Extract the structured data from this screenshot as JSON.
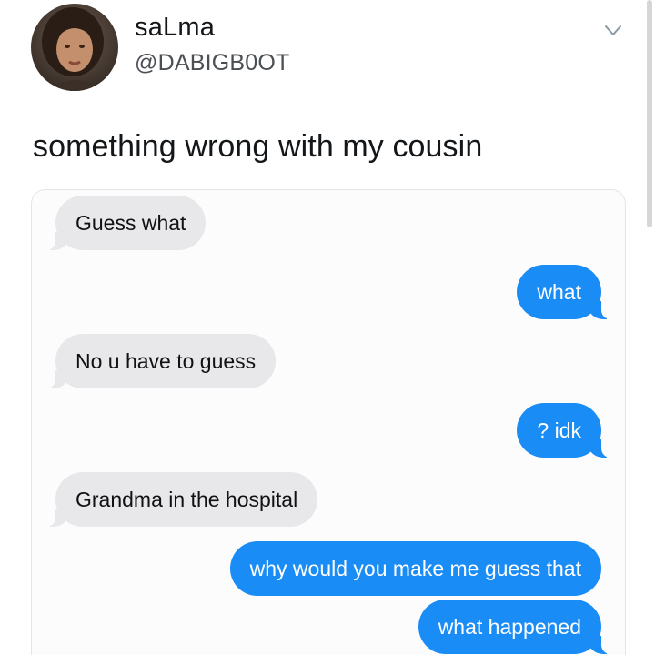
{
  "tweet": {
    "display_name": "saLma",
    "handle": "@DABIGB0OT",
    "text": "something wrong with my cousin",
    "menu_icon": "chevron-down-icon",
    "avatar_icon": "profile-avatar"
  },
  "conversation": {
    "messages": [
      {
        "direction": "received",
        "text": "Guess what"
      },
      {
        "direction": "sent",
        "text": "what"
      },
      {
        "direction": "received",
        "text": "No u have to guess"
      },
      {
        "direction": "sent",
        "text": "? idk"
      },
      {
        "direction": "received",
        "text": "Grandma in the hospital"
      },
      {
        "direction": "sent",
        "text": "why would you make me guess that"
      },
      {
        "direction": "sent",
        "text": "what happened"
      }
    ]
  },
  "colors": {
    "sent_bubble": "#1a8cf5",
    "received_bubble": "#e8e8eb",
    "text_primary": "#14171a",
    "text_secondary": "#4b4f54"
  }
}
